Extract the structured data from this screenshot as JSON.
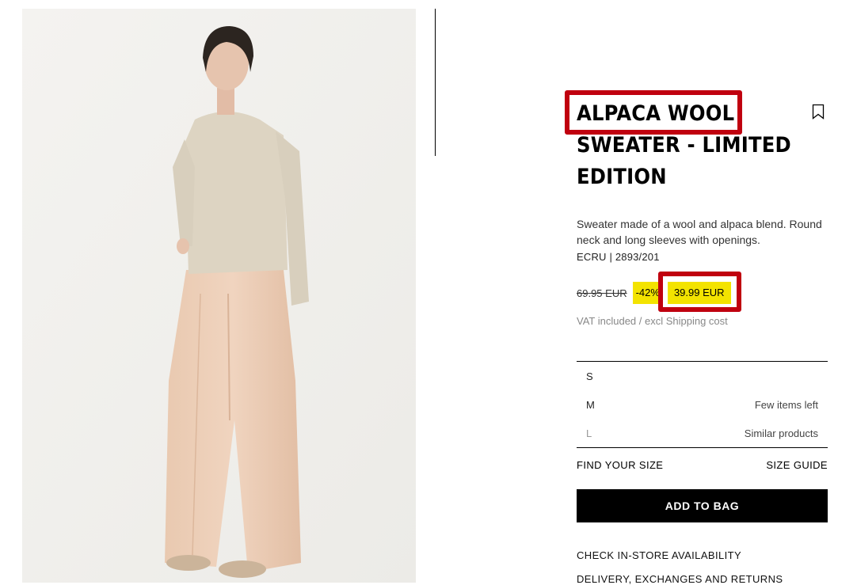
{
  "product": {
    "title": "ALPACA WOOL SWEATER - LIMITED EDITION",
    "description": "Sweater made of a wool and alpaca blend. Round neck and long sleeves with openings.",
    "reference": "ECRU | 2893/201",
    "price": {
      "original": "69.95 EUR",
      "discount": "-42%",
      "current": "39.99 EUR",
      "vat_note": "VAT included / excl Shipping cost"
    },
    "sizes": [
      {
        "name": "S",
        "note": ""
      },
      {
        "name": "M",
        "note": "Few items left"
      },
      {
        "name": "L",
        "note": "Similar products"
      }
    ],
    "find_size": "FIND YOUR SIZE",
    "size_guide": "SIZE GUIDE",
    "add_to_bag": "ADD TO BAG",
    "check_store": "CHECK IN-STORE AVAILABILITY",
    "delivery": "DELIVERY, EXCHANGES AND RETURNS"
  },
  "icons": {
    "bookmark": "bookmark-icon"
  },
  "colors": {
    "highlight_box": "#c0000f",
    "sale_badge": "#f3e300",
    "button": "#000000"
  }
}
